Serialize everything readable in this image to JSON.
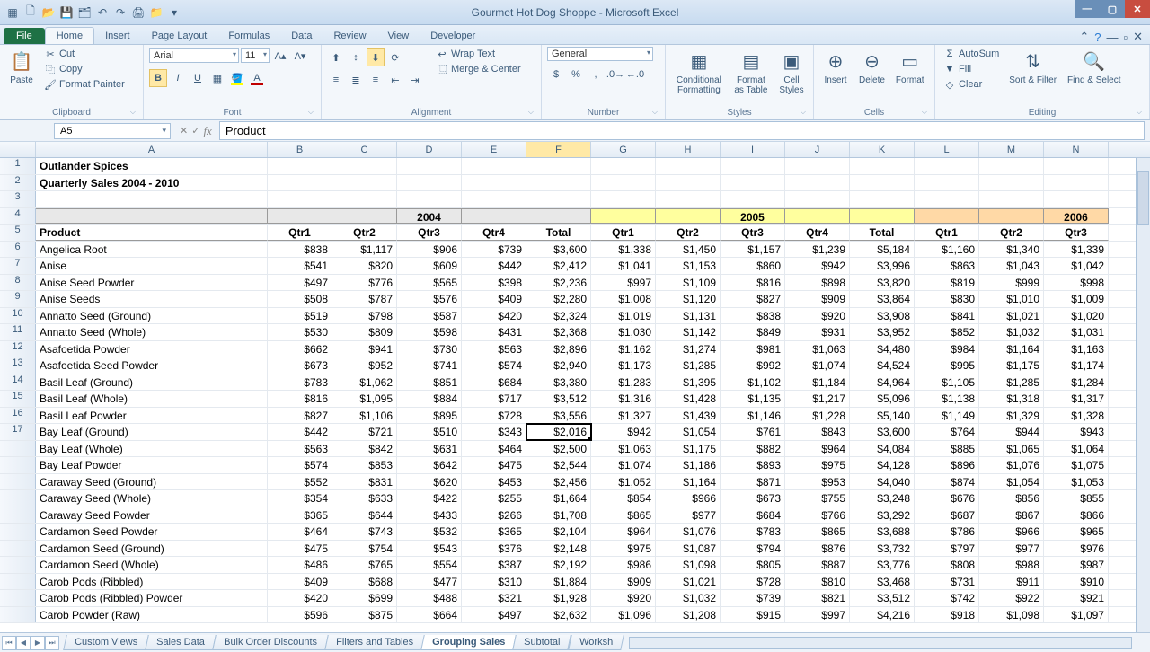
{
  "app": {
    "title": "Gourmet Hot Dog Shoppe - Microsoft Excel"
  },
  "tabs": {
    "file": "File",
    "home": "Home",
    "insert": "Insert",
    "pagelayout": "Page Layout",
    "formulas": "Formulas",
    "data": "Data",
    "review": "Review",
    "view": "View",
    "developer": "Developer"
  },
  "ribbon": {
    "clipboard": {
      "label": "Clipboard",
      "paste": "Paste",
      "cut": "Cut",
      "copy": "Copy",
      "fmtpainter": "Format Painter"
    },
    "font": {
      "label": "Font",
      "name": "Arial",
      "size": "11"
    },
    "alignment": {
      "label": "Alignment",
      "wrap": "Wrap Text",
      "merge": "Merge & Center"
    },
    "number": {
      "label": "Number",
      "format": "General"
    },
    "styles": {
      "label": "Styles",
      "cond": "Conditional\nFormatting",
      "table": "Format\nas Table",
      "cell": "Cell\nStyles"
    },
    "cells": {
      "label": "Cells",
      "insert": "Insert",
      "delete": "Delete",
      "format": "Format"
    },
    "editing": {
      "label": "Editing",
      "autosum": "AutoSum",
      "fill": "Fill",
      "clear": "Clear",
      "sort": "Sort &\nFilter",
      "find": "Find &\nSelect"
    }
  },
  "namebox": "A5",
  "formula": "Product",
  "columns": [
    "A",
    "B",
    "C",
    "D",
    "E",
    "F",
    "G",
    "H",
    "I",
    "J",
    "K",
    "L",
    "M",
    "N"
  ],
  "sheet": {
    "title1": "Outlander Spices",
    "title2": "Quarterly Sales 2004 - 2010",
    "years": [
      "2004",
      "2005",
      "2006"
    ],
    "qtrs": [
      "Product",
      "Qtr1",
      "Qtr2",
      "Qtr3",
      "Qtr4",
      "Total",
      "Qtr1",
      "Qtr2",
      "Qtr3",
      "Qtr4",
      "Total",
      "Qtr1",
      "Qtr2",
      "Qtr3"
    ],
    "rows": [
      {
        "n": 6,
        "p": "Angelica Root",
        "v": [
          "$838",
          "$1,117",
          "$906",
          "$739",
          "$3,600",
          "$1,338",
          "$1,450",
          "$1,157",
          "$1,239",
          "$5,184",
          "$1,160",
          "$1,340",
          "$1,339"
        ]
      },
      {
        "n": 7,
        "p": "Anise",
        "v": [
          "$541",
          "$820",
          "$609",
          "$442",
          "$2,412",
          "$1,041",
          "$1,153",
          "$860",
          "$942",
          "$3,996",
          "$863",
          "$1,043",
          "$1,042"
        ]
      },
      {
        "n": 8,
        "p": "Anise Seed Powder",
        "v": [
          "$497",
          "$776",
          "$565",
          "$398",
          "$2,236",
          "$997",
          "$1,109",
          "$816",
          "$898",
          "$3,820",
          "$819",
          "$999",
          "$998"
        ]
      },
      {
        "n": 9,
        "p": "Anise Seeds",
        "v": [
          "$508",
          "$787",
          "$576",
          "$409",
          "$2,280",
          "$1,008",
          "$1,120",
          "$827",
          "$909",
          "$3,864",
          "$830",
          "$1,010",
          "$1,009"
        ]
      },
      {
        "n": 10,
        "p": "Annatto Seed (Ground)",
        "v": [
          "$519",
          "$798",
          "$587",
          "$420",
          "$2,324",
          "$1,019",
          "$1,131",
          "$838",
          "$920",
          "$3,908",
          "$841",
          "$1,021",
          "$1,020"
        ]
      },
      {
        "n": 11,
        "p": "Annatto Seed (Whole)",
        "v": [
          "$530",
          "$809",
          "$598",
          "$431",
          "$2,368",
          "$1,030",
          "$1,142",
          "$849",
          "$931",
          "$3,952",
          "$852",
          "$1,032",
          "$1,031"
        ]
      },
      {
        "n": 12,
        "p": "Asafoetida Powder",
        "v": [
          "$662",
          "$941",
          "$730",
          "$563",
          "$2,896",
          "$1,162",
          "$1,274",
          "$981",
          "$1,063",
          "$4,480",
          "$984",
          "$1,164",
          "$1,163"
        ]
      },
      {
        "n": 13,
        "p": "Asafoetida Seed Powder",
        "v": [
          "$673",
          "$952",
          "$741",
          "$574",
          "$2,940",
          "$1,173",
          "$1,285",
          "$992",
          "$1,074",
          "$4,524",
          "$995",
          "$1,175",
          "$1,174"
        ]
      },
      {
        "n": 14,
        "p": "Basil Leaf (Ground)",
        "v": [
          "$783",
          "$1,062",
          "$851",
          "$684",
          "$3,380",
          "$1,283",
          "$1,395",
          "$1,102",
          "$1,184",
          "$4,964",
          "$1,105",
          "$1,285",
          "$1,284"
        ]
      },
      {
        "n": 15,
        "p": "Basil Leaf (Whole)",
        "v": [
          "$816",
          "$1,095",
          "$884",
          "$717",
          "$3,512",
          "$1,316",
          "$1,428",
          "$1,135",
          "$1,217",
          "$5,096",
          "$1,138",
          "$1,318",
          "$1,317"
        ]
      },
      {
        "n": 16,
        "p": "Basil Leaf Powder",
        "v": [
          "$827",
          "$1,106",
          "$895",
          "$728",
          "$3,556",
          "$1,327",
          "$1,439",
          "$1,146",
          "$1,228",
          "$5,140",
          "$1,149",
          "$1,329",
          "$1,328"
        ]
      },
      {
        "n": 17,
        "p": "Bay Leaf (Ground)",
        "v": [
          "$442",
          "$721",
          "$510",
          "$343",
          "$2,016",
          "$942",
          "$1,054",
          "$761",
          "$843",
          "$3,600",
          "$764",
          "$944",
          "$943"
        ]
      },
      {
        "n": "",
        "p": "Bay Leaf (Whole)",
        "v": [
          "$563",
          "$842",
          "$631",
          "$464",
          "$2,500",
          "$1,063",
          "$1,175",
          "$882",
          "$964",
          "$4,084",
          "$885",
          "$1,065",
          "$1,064"
        ]
      },
      {
        "n": "",
        "p": "Bay Leaf Powder",
        "v": [
          "$574",
          "$853",
          "$642",
          "$475",
          "$2,544",
          "$1,074",
          "$1,186",
          "$893",
          "$975",
          "$4,128",
          "$896",
          "$1,076",
          "$1,075"
        ]
      },
      {
        "n": "",
        "p": "Caraway Seed (Ground)",
        "v": [
          "$552",
          "$831",
          "$620",
          "$453",
          "$2,456",
          "$1,052",
          "$1,164",
          "$871",
          "$953",
          "$4,040",
          "$874",
          "$1,054",
          "$1,053"
        ]
      },
      {
        "n": "",
        "p": "Caraway Seed (Whole)",
        "v": [
          "$354",
          "$633",
          "$422",
          "$255",
          "$1,664",
          "$854",
          "$966",
          "$673",
          "$755",
          "$3,248",
          "$676",
          "$856",
          "$855"
        ]
      },
      {
        "n": "",
        "p": "Caraway Seed Powder",
        "v": [
          "$365",
          "$644",
          "$433",
          "$266",
          "$1,708",
          "$865",
          "$977",
          "$684",
          "$766",
          "$3,292",
          "$687",
          "$867",
          "$866"
        ]
      },
      {
        "n": "",
        "p": "Cardamon Seed  Powder",
        "v": [
          "$464",
          "$743",
          "$532",
          "$365",
          "$2,104",
          "$964",
          "$1,076",
          "$783",
          "$865",
          "$3,688",
          "$786",
          "$966",
          "$965"
        ]
      },
      {
        "n": "",
        "p": "Cardamon Seed (Ground)",
        "v": [
          "$475",
          "$754",
          "$543",
          "$376",
          "$2,148",
          "$975",
          "$1,087",
          "$794",
          "$876",
          "$3,732",
          "$797",
          "$977",
          "$976"
        ]
      },
      {
        "n": "",
        "p": "Cardamon Seed (Whole)",
        "v": [
          "$486",
          "$765",
          "$554",
          "$387",
          "$2,192",
          "$986",
          "$1,098",
          "$805",
          "$887",
          "$3,776",
          "$808",
          "$988",
          "$987"
        ]
      },
      {
        "n": "",
        "p": "Carob Pods (Ribbled)",
        "v": [
          "$409",
          "$688",
          "$477",
          "$310",
          "$1,884",
          "$909",
          "$1,021",
          "$728",
          "$810",
          "$3,468",
          "$731",
          "$911",
          "$910"
        ]
      },
      {
        "n": "",
        "p": "Carob Pods (Ribbled) Powder",
        "v": [
          "$420",
          "$699",
          "$488",
          "$321",
          "$1,928",
          "$920",
          "$1,032",
          "$739",
          "$821",
          "$3,512",
          "$742",
          "$922",
          "$921"
        ]
      },
      {
        "n": "",
        "p": "Carob Powder (Raw)",
        "v": [
          "$596",
          "$875",
          "$664",
          "$497",
          "$2,632",
          "$1,096",
          "$1,208",
          "$915",
          "$997",
          "$4,216",
          "$918",
          "$1,098",
          "$1,097"
        ]
      }
    ]
  },
  "sheettabs": [
    "Custom Views",
    "Sales Data",
    "Bulk Order Discounts",
    "Filters and Tables",
    "Grouping Sales",
    "Subtotal",
    "Worksh"
  ]
}
